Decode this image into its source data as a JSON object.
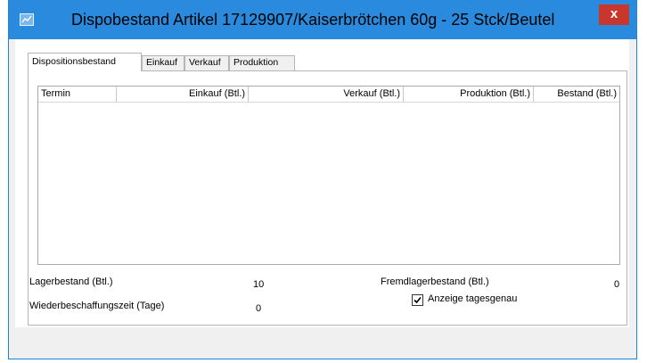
{
  "window": {
    "title": "Dispobestand Artikel 17129907/Kaiserbrötchen 60g - 25 Stck/Beutel",
    "close_symbol": "x",
    "app_icon": "chart-window-icon"
  },
  "tabs": [
    {
      "label": "Dispositionsbestand",
      "active": true
    },
    {
      "label": "Einkauf",
      "active": false
    },
    {
      "label": "Verkauf",
      "active": false
    },
    {
      "label": "Produktion",
      "active": false
    }
  ],
  "grid": {
    "columns": [
      "Termin",
      "Einkauf (Btl.)",
      "Verkauf (Btl.)",
      "Produktion (Btl.)",
      "Bestand (Btl.)"
    ],
    "rows": []
  },
  "fields": {
    "lagerbestand_label": "Lagerbestand (Btl.)",
    "lagerbestand_value": "10",
    "fremdlager_label": "Fremdlagerbestand (Btl.)",
    "fremdlager_value": "0",
    "wiederbeschaffung_label": "Wiederbeschaffungszeit (Tage)",
    "wiederbeschaffung_value": "0"
  },
  "option": {
    "label": "Anzeige tagesgenau",
    "checked": true
  },
  "colors": {
    "titlebar": "#2a8bde",
    "close_button": "#c7372e",
    "window_border": "#1f83d6"
  }
}
